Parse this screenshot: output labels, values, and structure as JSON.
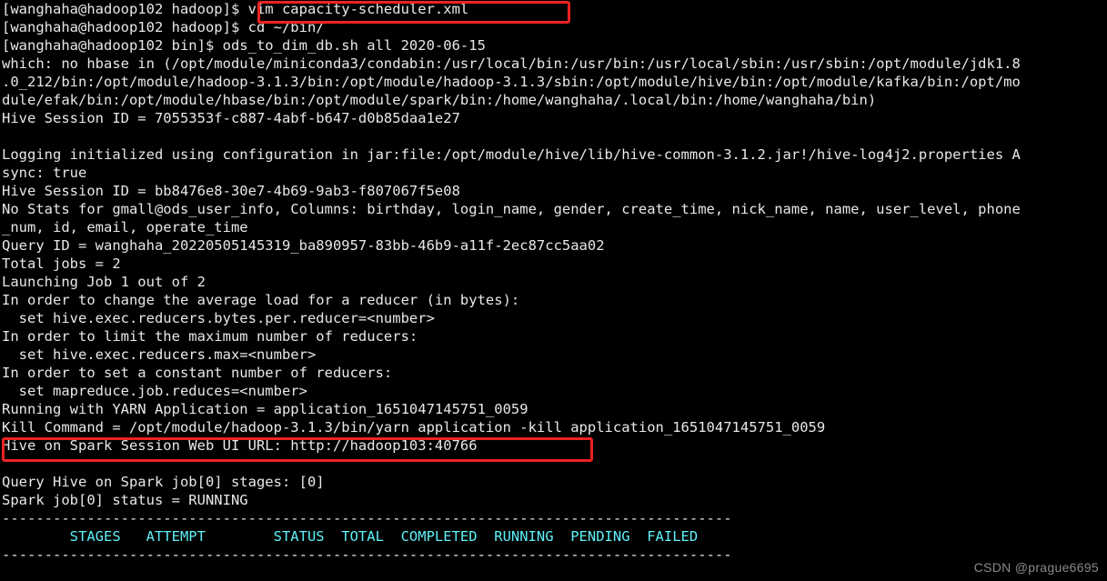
{
  "terminal": {
    "background_color": "#000000",
    "foreground_color": "#e8e8e8",
    "accent_cyan": "#5ff1f8",
    "annotation_color": "#ee2222",
    "lines": [
      {
        "id": "l01",
        "color": "white",
        "text": "[wanghaha@hadoop102 hadoop]$ vim capacity-scheduler.xml"
      },
      {
        "id": "l02",
        "color": "white",
        "text": "[wanghaha@hadoop102 hadoop]$ cd ~/bin/"
      },
      {
        "id": "l03",
        "color": "white",
        "text": "[wanghaha@hadoop102 bin]$ ods_to_dim_db.sh all 2020-06-15"
      },
      {
        "id": "l04",
        "color": "white",
        "text": "which: no hbase in (/opt/module/miniconda3/condabin:/usr/local/bin:/usr/bin:/usr/local/sbin:/usr/sbin:/opt/module/jdk1.8"
      },
      {
        "id": "l05",
        "color": "white",
        "text": ".0_212/bin:/opt/module/hadoop-3.1.3/bin:/opt/module/hadoop-3.1.3/sbin:/opt/module/hive/bin:/opt/module/kafka/bin:/opt/mo"
      },
      {
        "id": "l06",
        "color": "white",
        "text": "dule/efak/bin:/opt/module/hbase/bin:/opt/module/spark/bin:/home/wanghaha/.local/bin:/home/wanghaha/bin)"
      },
      {
        "id": "l07",
        "color": "white",
        "text": "Hive Session ID = 7055353f-c887-4abf-b647-d0b85daa1e27"
      },
      {
        "id": "l08",
        "color": "white",
        "text": ""
      },
      {
        "id": "l09",
        "color": "white",
        "text": "Logging initialized using configuration in jar:file:/opt/module/hive/lib/hive-common-3.1.2.jar!/hive-log4j2.properties A"
      },
      {
        "id": "l10",
        "color": "white",
        "text": "sync: true"
      },
      {
        "id": "l11",
        "color": "white",
        "text": "Hive Session ID = bb8476e8-30e7-4b69-9ab3-f807067f5e08"
      },
      {
        "id": "l12",
        "color": "white",
        "text": "No Stats for gmall@ods_user_info, Columns: birthday, login_name, gender, create_time, nick_name, name, user_level, phone"
      },
      {
        "id": "l13",
        "color": "white",
        "text": "_num, id, email, operate_time"
      },
      {
        "id": "l14",
        "color": "white",
        "text": "Query ID = wanghaha_20220505145319_ba890957-83bb-46b9-a11f-2ec87cc5aa02"
      },
      {
        "id": "l15",
        "color": "white",
        "text": "Total jobs = 2"
      },
      {
        "id": "l16",
        "color": "white",
        "text": "Launching Job 1 out of 2"
      },
      {
        "id": "l17",
        "color": "white",
        "text": "In order to change the average load for a reducer (in bytes):"
      },
      {
        "id": "l18",
        "color": "white",
        "text": "  set hive.exec.reducers.bytes.per.reducer=<number>"
      },
      {
        "id": "l19",
        "color": "white",
        "text": "In order to limit the maximum number of reducers:"
      },
      {
        "id": "l20",
        "color": "white",
        "text": "  set hive.exec.reducers.max=<number>"
      },
      {
        "id": "l21",
        "color": "white",
        "text": "In order to set a constant number of reducers:"
      },
      {
        "id": "l22",
        "color": "white",
        "text": "  set mapreduce.job.reduces=<number>"
      },
      {
        "id": "l23",
        "color": "white",
        "text": "Running with YARN Application = application_1651047145751_0059"
      },
      {
        "id": "l24",
        "color": "white",
        "text": "Kill Command = /opt/module/hadoop-3.1.3/bin/yarn application -kill application_1651047145751_0059"
      },
      {
        "id": "l25",
        "color": "white",
        "text": "Hive on Spark Session Web UI URL: http://hadoop103:40766"
      },
      {
        "id": "l26",
        "color": "white",
        "text": ""
      },
      {
        "id": "l27",
        "color": "white",
        "text": "Query Hive on Spark job[0] stages: [0]"
      },
      {
        "id": "l28",
        "color": "white",
        "text": "Spark job[0] status = RUNNING"
      },
      {
        "id": "l29",
        "color": "white",
        "text": "--------------------------------------------------------------------------------------"
      },
      {
        "id": "l30",
        "color": "cyan",
        "text": "        STAGES   ATTEMPT        STATUS  TOTAL  COMPLETED  RUNNING  PENDING  FAILED"
      },
      {
        "id": "l31",
        "color": "white",
        "text": "--------------------------------------------------------------------------------------"
      }
    ],
    "annotations": [
      {
        "id": "redbox-vim",
        "label": "highlight-vim-command",
        "target_text": "vim capacity-scheduler.xml"
      },
      {
        "id": "redbox-url",
        "label": "highlight-spark-web-ui-url",
        "target_text": "Hive on Spark Session Web UI URL: http://hadoop103:40766"
      }
    ],
    "progress_table": {
      "headers": [
        "STAGES",
        "ATTEMPT",
        "STATUS",
        "TOTAL",
        "COMPLETED",
        "RUNNING",
        "PENDING",
        "FAILED"
      ],
      "rows": []
    }
  },
  "watermark": {
    "text": "CSDN @prague6695"
  }
}
